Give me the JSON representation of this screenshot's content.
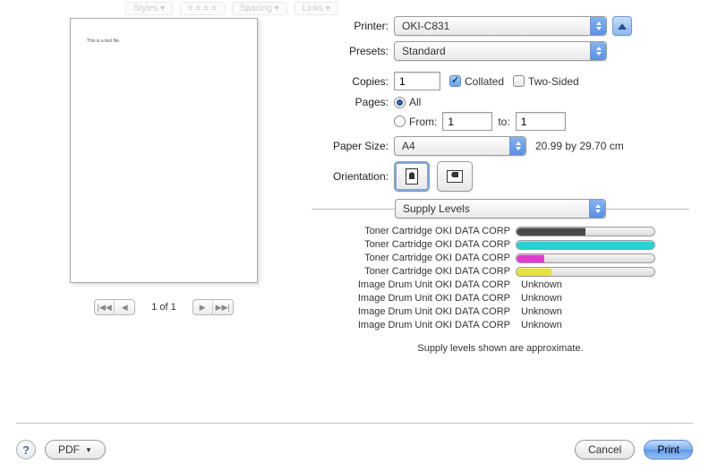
{
  "form": {
    "printer_label": "Printer:",
    "printer_value": "OKI-C831",
    "presets_label": "Presets:",
    "presets_value": "Standard",
    "copies_label": "Copies:",
    "copies_value": "1",
    "collated_label": "Collated",
    "twosided_label": "Two-Sided",
    "pages_label": "Pages:",
    "pages_all": "All",
    "pages_from": "From:",
    "pages_from_value": "1",
    "pages_to": "to:",
    "pages_to_value": "1",
    "papersize_label": "Paper Size:",
    "papersize_value": "A4",
    "papersize_dims": "20.99 by 29.70 cm",
    "orientation_label": "Orientation:",
    "section_value": "Supply Levels"
  },
  "preview": {
    "sample_text": "This is a test file.",
    "pager_text": "1 of 1"
  },
  "supplies": {
    "items": [
      {
        "label": "Toner Cartridge OKI DATA CORP",
        "kind": "bar",
        "percent": 50,
        "color": "#4a4a4a"
      },
      {
        "label": "Toner Cartridge OKI DATA CORP",
        "kind": "bar",
        "percent": 100,
        "color": "#26d2d4"
      },
      {
        "label": "Toner Cartridge OKI DATA CORP",
        "kind": "bar",
        "percent": 20,
        "color": "#e23bd0"
      },
      {
        "label": "Toner Cartridge OKI DATA CORP",
        "kind": "bar",
        "percent": 25,
        "color": "#e7e23a"
      },
      {
        "label": "Image Drum Unit OKI DATA CORP",
        "kind": "text",
        "text": "Unknown"
      },
      {
        "label": "Image Drum Unit OKI DATA CORP",
        "kind": "text",
        "text": "Unknown"
      },
      {
        "label": "Image Drum Unit OKI DATA CORP",
        "kind": "text",
        "text": "Unknown"
      },
      {
        "label": "Image Drum Unit OKI DATA CORP",
        "kind": "text",
        "text": "Unknown"
      }
    ],
    "footnote": "Supply levels shown are approximate."
  },
  "footer": {
    "pdf_label": "PDF",
    "cancel_label": "Cancel",
    "print_label": "Print"
  }
}
